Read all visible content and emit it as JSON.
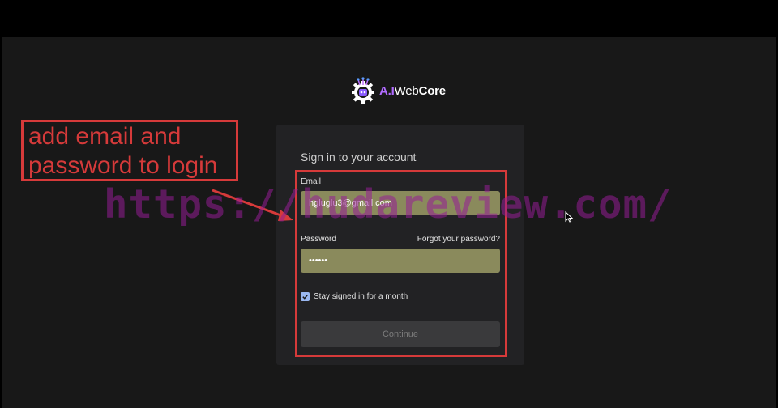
{
  "logo": {
    "part_ai": "A.I",
    "part_web": "Web",
    "part_core": "Core",
    "icon": "gear-robot-icon"
  },
  "signin": {
    "title": "Sign in to your account",
    "email_label": "Email",
    "email_value": "hgluglu3@gmail.com",
    "password_label": "Password",
    "password_value": "••••••",
    "forgot_link": "Forgot your password?",
    "stay_signed_in_label": "Stay signed in for a month",
    "stay_signed_in_checked": true,
    "continue_label": "Continue"
  },
  "annotation": {
    "callout_text": "add email and password to login",
    "color": "#d63a3a"
  },
  "watermark": {
    "text": "https://hudareview.com/"
  },
  "colors": {
    "background": "#181818",
    "card": "#222224",
    "input_autofill": "#8a8a5c",
    "checkbox": "#9ab8f0",
    "button": "#3a3a3c"
  }
}
